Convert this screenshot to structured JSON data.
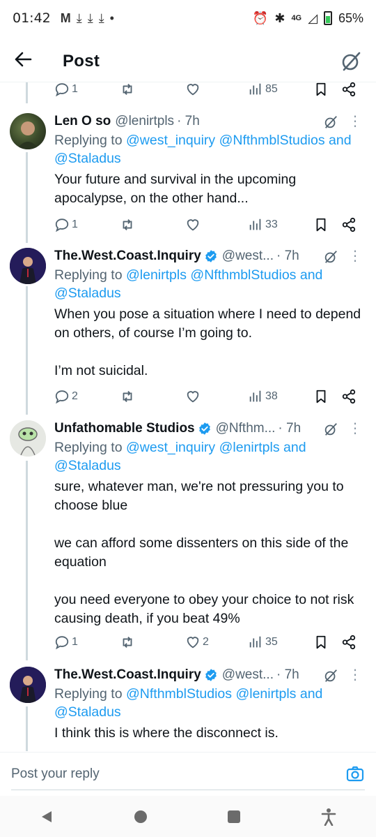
{
  "status_bar": {
    "time": "01:42",
    "left_icons": [
      "gmail-icon",
      "download-icon",
      "download-icon",
      "download-icon",
      "dot-icon"
    ],
    "network": "4G",
    "battery": "65%"
  },
  "header": {
    "title": "Post"
  },
  "top_actions": {
    "replies": "1",
    "views": "85"
  },
  "tweets": [
    {
      "name": "Len O so",
      "handle": "@lenirtpls",
      "time": "· 7h",
      "verified": false,
      "replying_prefix": "Replying to ",
      "mentions": [
        "@west_inquiry",
        "@NfthmblStudios"
      ],
      "and": " and",
      "mention_last": "@Staladus",
      "text": "Your future and survival in the upcoming apocalypse, on the other hand...",
      "replies": "1",
      "retweets": "",
      "likes": "",
      "views": "33"
    },
    {
      "name": "The.West.Coast.Inquiry",
      "handle": "@west...",
      "time": "· 7h",
      "verified": true,
      "replying_prefix": "Replying to ",
      "mentions": [
        "@lenirtpls",
        "@NfthmblStudios"
      ],
      "and": " and",
      "mention_last": "@Staladus",
      "text": "When you pose a situation where I need to depend on others, of course I’m going to.\n\nI’m not suicidal.",
      "replies": "2",
      "retweets": "",
      "likes": "",
      "views": "38"
    },
    {
      "name": "Unfathomable Studios",
      "handle": "@Nfthm...",
      "time": "· 7h",
      "verified": true,
      "replying_prefix": "Replying to ",
      "mentions": [
        "@west_inquiry",
        "@lenirtpls"
      ],
      "and": " and",
      "mention_last": "@Staladus",
      "text": "sure, whatever man, we're not pressuring you to choose blue\n\nwe can afford some dissenters on this side of the equation\n\nyou need everyone to obey your choice to not risk causing death, if you beat 49%",
      "replies": "1",
      "retweets": "",
      "likes": "2",
      "views": "35"
    },
    {
      "name": "The.West.Coast.Inquiry",
      "handle": "@west...",
      "time": "· 7h",
      "verified": true,
      "replying_prefix": "Replying to ",
      "mentions": [
        "@NfthmblStudios",
        "@lenirtpls"
      ],
      "and": " and",
      "mention_last": "@Staladus",
      "text": "I think this is where the disconnect is."
    }
  ],
  "composer": {
    "placeholder": "Post your reply"
  },
  "colors": {
    "link": "#1d9bf0",
    "secondary": "#536471",
    "verified": "#1d9bf0",
    "text": "#0f1419"
  }
}
